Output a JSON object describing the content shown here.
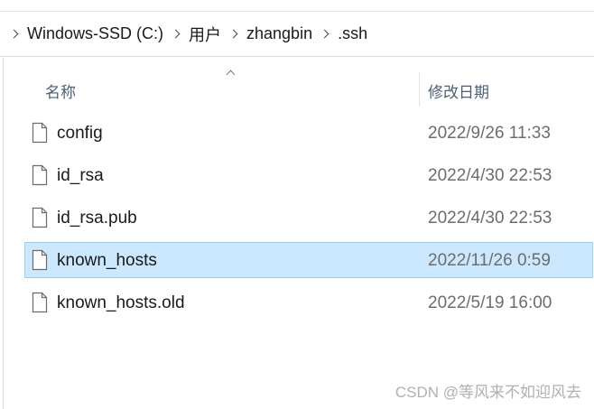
{
  "breadcrumb": {
    "items": [
      {
        "label": "Windows-SSD (C:)"
      },
      {
        "label": "用户"
      },
      {
        "label": "zhangbin"
      },
      {
        "label": ".ssh"
      }
    ]
  },
  "columns": {
    "name_label": "名称",
    "date_label": "修改日期",
    "sort_indicator": "up-caret"
  },
  "files": [
    {
      "name": "config",
      "date": "2022/9/26 11:33",
      "selected": false,
      "icon": "file-icon"
    },
    {
      "name": "id_rsa",
      "date": "2022/4/30 22:53",
      "selected": false,
      "icon": "file-icon"
    },
    {
      "name": "id_rsa.pub",
      "date": "2022/4/30 22:53",
      "selected": false,
      "icon": "file-icon"
    },
    {
      "name": "known_hosts",
      "date": "2022/11/26 0:59",
      "selected": true,
      "icon": "file-icon"
    },
    {
      "name": "known_hosts.old",
      "date": "2022/5/19 16:00",
      "selected": false,
      "icon": "file-icon"
    }
  ],
  "watermark": "CSDN @等风来不如迎风去",
  "colors": {
    "selection_bg": "#cce8ff",
    "selection_border": "#99d1ff",
    "header_text": "#4c607a",
    "date_text": "#6d6d6d"
  }
}
